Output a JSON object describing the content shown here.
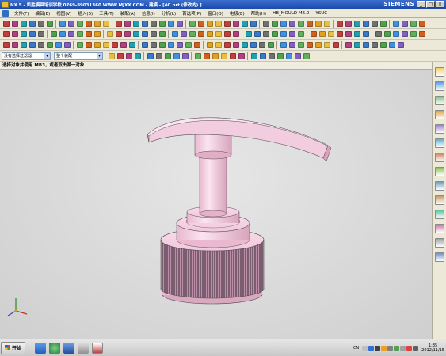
{
  "window": {
    "title": "NX 5 - 凯胜模具培训学校 0769-89031360 WWW.MJXX.COM - 建模 - [4C.prt (修改的) ]",
    "brand": "SIEMENS",
    "minimize": "_",
    "maximize": "□",
    "close": "×"
  },
  "menu": {
    "items": [
      "文件(F)",
      "编辑(E)",
      "视图(V)",
      "插入(S)",
      "工具(T)",
      "装配(A)",
      "信息(I)",
      "分析(L)",
      "首选项(P)",
      "窗口(O)",
      "电极(E)",
      "帮助(H)",
      "HB_MOULD M6.0",
      "YSUC"
    ]
  },
  "toolbar": {
    "selection_filter": "没有选择过滤器",
    "assembly_scope": "整个装配"
  },
  "cue_line": "选择对象并使用 MB3，或者双击某一对象",
  "taskbar": {
    "start_label": "开始",
    "language": "CN",
    "time": "1:35",
    "date": "2012/11/15"
  },
  "colors": {
    "titlebar": "#1a4aa8",
    "part": "#f0c8dc",
    "knurl": "#4a3a44"
  }
}
